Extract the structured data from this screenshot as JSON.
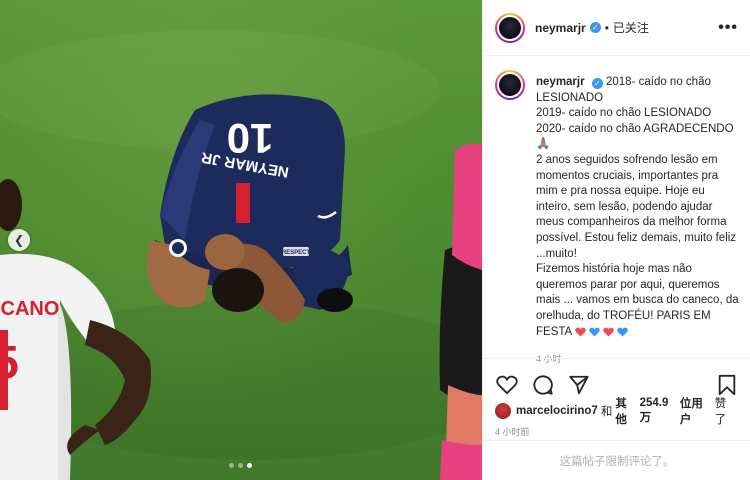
{
  "post": {
    "username": "neymarjr",
    "follow_status": "已关注",
    "more_menu": "•••"
  },
  "caption": {
    "username": "neymarjr",
    "text": "2018- caído no chão LESIONADO\n2019- caído no chão LESIONADO\n2020- caído no chão AGRADECENDO\n🙏🏽\n2 anos seguidos sofrendo lesão em momentos cruciais, importantes pra mim e pra nossa equipe. Hoje eu inteiro, sem lesão, podendo ajudar meus companheiros da melhor forma possível. Estou feliz demais, muito feliz ...muito!\nFizemos história hoje mas não queremos parar por aqui, queremos mais ... vamos em busca do caneco, da orelhuda, do TROFÉU! PARIS EM FESTA",
    "hearts": [
      "red",
      "blue",
      "red",
      "blue"
    ],
    "time": "4 小时"
  },
  "photo": {
    "jersey_number": "10",
    "jersey_name": "NEYMAR JR",
    "opponent_name": "CANO",
    "opponent_number": "5",
    "sleeve_text": "RESPECT",
    "carousel_total": 3,
    "carousel_active": 2
  },
  "actions": {
    "like": "heart-outline-icon",
    "comment": "comment-icon",
    "share": "share-icon",
    "save": "bookmark-icon"
  },
  "likes": {
    "user": "marcelocirino7",
    "and": "和",
    "others_label": "其他",
    "count": "254.9万",
    "suffix": "位用户",
    "liked": "赞了"
  },
  "time_posted": "4 小时前",
  "comments_notice": "这篇帖子限制评论了。",
  "colors": {
    "heart_red": "#ed4956",
    "heart_blue": "#3897f0",
    "verified": "#3897f0",
    "pitch": "#4f8c31",
    "psg_navy": "#1d2a5c"
  }
}
